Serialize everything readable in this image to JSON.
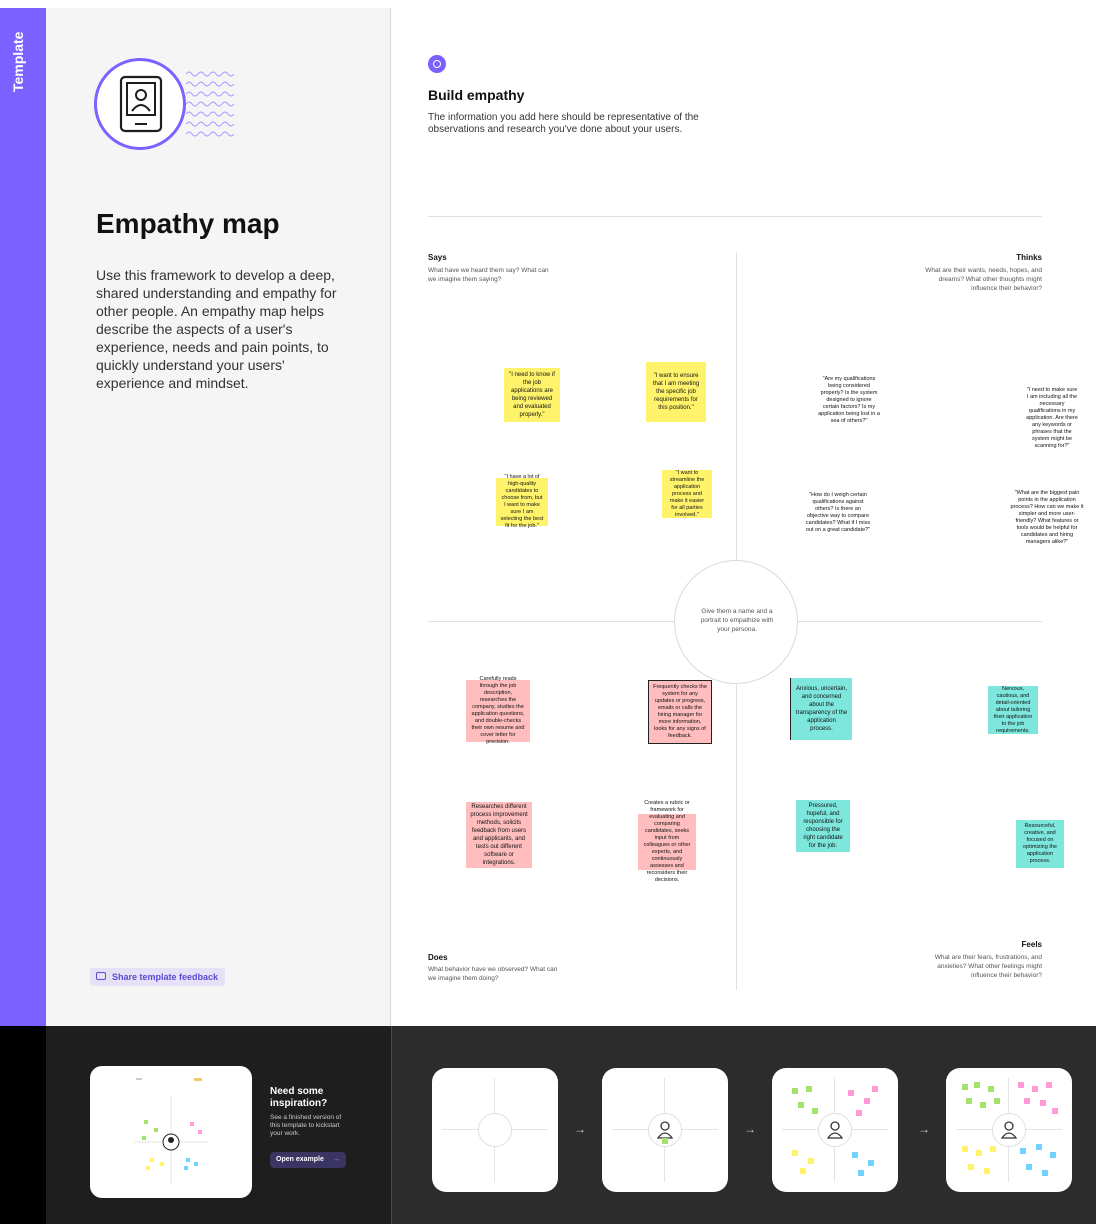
{
  "sidebar": {
    "label": "Template"
  },
  "info": {
    "title": "Empathy map",
    "description": "Use this framework to develop a deep, shared understanding and empathy for other people. An empathy map helps describe the aspects of a user's experience, needs and pain points, to quickly understand your users' experience and mindset.",
    "feedback_label": "Share template feedback"
  },
  "canvas": {
    "heading": "Build empathy",
    "intro": "The information you add here should be representative of the observations and research you've done about your users.",
    "center": "Give them a name and a portrait to empathize with your persona.",
    "quadrants": {
      "says": {
        "title": "Says",
        "sub": "What have we heard them say? What can we imagine them saying?"
      },
      "thinks": {
        "title": "Thinks",
        "sub": "What are their wants, needs, hopes, and dreams? What other thoughts might influence their behavior?"
      },
      "does": {
        "title": "Does",
        "sub": "What behavior have we observed? What can we imagine them doing?"
      },
      "feels": {
        "title": "Feels",
        "sub": "What are their fears, frustrations, and anxieties? What other feelings might influence their behavior?"
      }
    },
    "stickies": {
      "says1": "\"I need to know if the job applications are being reviewed and evaluated properly.\"",
      "says2": "\"I want to ensure that I am meeting the specific job requirements for this position.\"",
      "says3": "\"I have a lot of high-quality candidates to choose from, but I want to make sure I am selecting the best fit for the job.\"",
      "says4": "\"I want to streamline the application process and make it easier for all parties involved.\"",
      "thinks1": "\"Are my qualifications being considered properly? Is the system designed to ignore certain factors? Is my application being lost in a sea of others?\"",
      "thinks2": "\"I need to make sure I am including all the necessary qualifications in my application. Are there any keywords or phrases that the system might be scanning for?\"",
      "thinks3": "\"How do I weigh certain qualifications against others? Is there an objective way to compare candidates? What if I miss out on a great candidate?\"",
      "thinks4": "\"What are the biggest pain points in the application process? How can we make it simpler and more user-friendly? What features or tools would be helpful for candidates and hiring managers alike?\"",
      "does1": "Carefully reads through the job description, researches the company, studies the application questions, and double-checks their own resume and cover letter for precision.",
      "does2": "Frequently checks the system for any updates or progress, emails or calls the hiring manager for more information, looks for any signs of feedback.",
      "does3": "Researches different process improvement methods, solicits feedback from users and applicants, and tests out different software or integrations.",
      "does4": "Creates a rubric or framework for evaluating and comparing candidates, seeks input from colleagues or other experts, and continuously assesses and reconsiders their decisions.",
      "feels1": "Anxious, uncertain, and concerned about the transparency of the application process.",
      "feels2": "Nervous, cautious, and detail-oriented about tailoring their application to the job requirements.",
      "feels3": "Pressured, hopeful, and responsible for choosing the right candidate for the job.",
      "feels4": "Resourceful, creative, and focused on optimizing the application process."
    }
  },
  "inspiration": {
    "title": "Need some inspiration?",
    "sub": "See a finished version of this template to kickstart your work.",
    "button": "Open example",
    "arrow": "→"
  },
  "steps": {
    "arrow": "→"
  },
  "colors": {
    "accent": "#7b61ff",
    "yellow": "#fff36b",
    "pink": "#ffbdbd",
    "teal": "#7ee7dd"
  }
}
